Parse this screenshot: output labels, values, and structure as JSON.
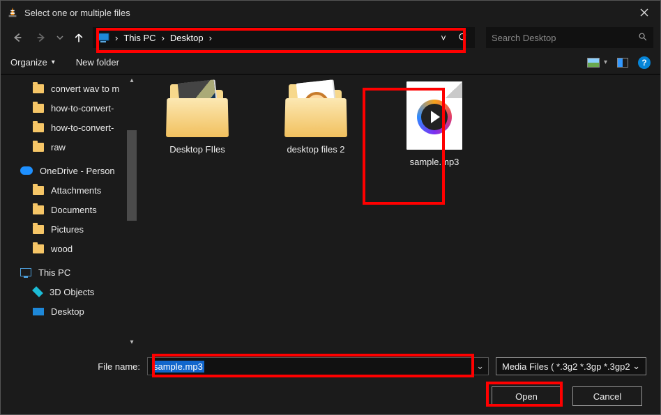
{
  "title": "Select one or multiple files",
  "breadcrumb": {
    "root": "This PC",
    "current": "Desktop"
  },
  "search": {
    "placeholder": "Search Desktop"
  },
  "toolbar": {
    "organize": "Organize",
    "new_folder": "New folder",
    "help": "?"
  },
  "sidebar": {
    "items": [
      {
        "kind": "folder",
        "label": "convert wav to m"
      },
      {
        "kind": "folder",
        "label": "how-to-convert-"
      },
      {
        "kind": "folder",
        "label": "how-to-convert-"
      },
      {
        "kind": "folder",
        "label": "raw"
      }
    ],
    "onedrive": {
      "label": "OneDrive - Person",
      "items": [
        {
          "label": "Attachments"
        },
        {
          "label": "Documents"
        },
        {
          "label": "Pictures"
        },
        {
          "label": "wood"
        }
      ]
    },
    "thispc": {
      "label": "This PC",
      "items": [
        {
          "label": "3D Objects"
        },
        {
          "label": "Desktop"
        }
      ]
    }
  },
  "files": [
    {
      "name": "Desktop FIles",
      "type": "folder"
    },
    {
      "name": "desktop files 2",
      "type": "folder"
    },
    {
      "name": "sample.mp3",
      "type": "media"
    }
  ],
  "footer": {
    "file_name_label": "File name:",
    "file_name_value": "sample.mp3",
    "filter_label": "Media Files ( *.3g2 *.3gp *.3gp2",
    "open": "Open",
    "cancel": "Cancel"
  }
}
